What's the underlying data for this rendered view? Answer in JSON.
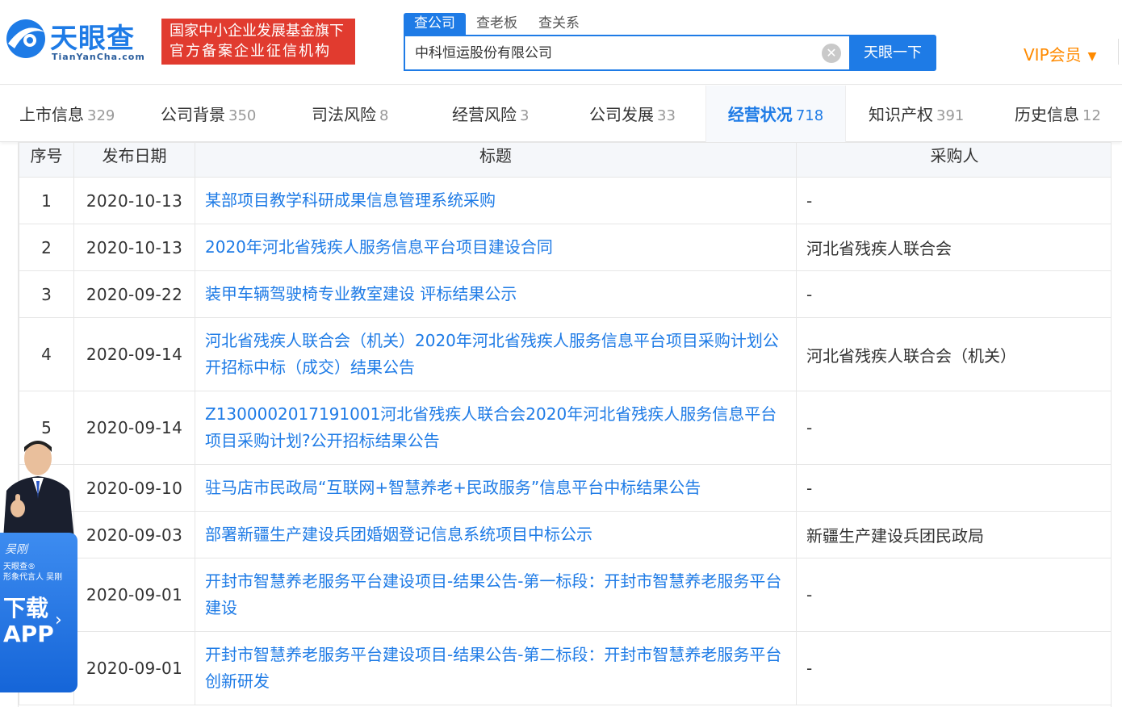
{
  "header": {
    "logo_text": "天眼查",
    "logo_sub": "TianYanCha.com",
    "badge_line1": "国家中小企业发展基金旗下",
    "badge_line2": "官方备案企业征信机构",
    "search_tabs": [
      "查公司",
      "查老板",
      "查关系"
    ],
    "search_value": "中科恒运股份有限公司",
    "search_button": "天眼一下",
    "vip": "VIP会员"
  },
  "tabs": [
    {
      "label": "上市信息",
      "count": "329"
    },
    {
      "label": "公司背景",
      "count": "350"
    },
    {
      "label": "司法风险",
      "count": "8"
    },
    {
      "label": "经营风险",
      "count": "3"
    },
    {
      "label": "公司发展",
      "count": "33"
    },
    {
      "label": "经营状况",
      "count": "718"
    },
    {
      "label": "知识产权",
      "count": "391"
    },
    {
      "label": "历史信息",
      "count": "12"
    }
  ],
  "table": {
    "headers": [
      "序号",
      "发布日期",
      "标题",
      "采购人"
    ],
    "rows": [
      {
        "num": "1",
        "date": "2020-10-13",
        "title": "某部项目教学科研成果信息管理系统采购",
        "buyer": "-"
      },
      {
        "num": "2",
        "date": "2020-10-13",
        "title": "2020年河北省残疾人服务信息平台项目建设合同",
        "buyer": "河北省残疾人联合会"
      },
      {
        "num": "3",
        "date": "2020-09-22",
        "title": "装甲车辆驾驶椅专业教室建设 评标结果公示",
        "buyer": "-"
      },
      {
        "num": "4",
        "date": "2020-09-14",
        "title": "河北省残疾人联合会（机关）2020年河北省残疾人服务信息平台项目采购计划公开招标中标（成交）结果公告",
        "buyer": "河北省残疾人联合会（机关）"
      },
      {
        "num": "5",
        "date": "2020-09-14",
        "title": "Z1300002017191001河北省残疾人联合会2020年河北省残疾人服务信息平台项目采购计划?公开招标结果公告",
        "buyer": "-"
      },
      {
        "num": "6",
        "date": "2020-09-10",
        "title": "驻马店市民政局“互联网+智慧养老+民政服务”信息平台中标结果公告",
        "buyer": "-"
      },
      {
        "num": "7",
        "date": "2020-09-03",
        "title": "部署新疆生产建设兵团婚姻登记信息系统项目中标公示",
        "buyer": "新疆生产建设兵团民政局"
      },
      {
        "num": "8",
        "date": "2020-09-01",
        "title": "开封市智慧养老服务平台建设项目-结果公告-第一标段：开封市智慧养老服务平台建设",
        "buyer": "-"
      },
      {
        "num": "9",
        "date": "2020-09-01",
        "title": "开封市智慧养老服务平台建设项目-结果公告-第二标段：开封市智慧养老服务平台创新研发",
        "buyer": "-"
      }
    ]
  },
  "ad": {
    "signature": "吴刚",
    "brand_line1": "天眼查®",
    "brand_line2": "形象代言人 吴刚",
    "download_line1": "下载",
    "download_line2": "APP"
  },
  "colors": {
    "primary": "#1e7be6",
    "badge": "#e13b2f",
    "vip": "#ff8a00"
  }
}
